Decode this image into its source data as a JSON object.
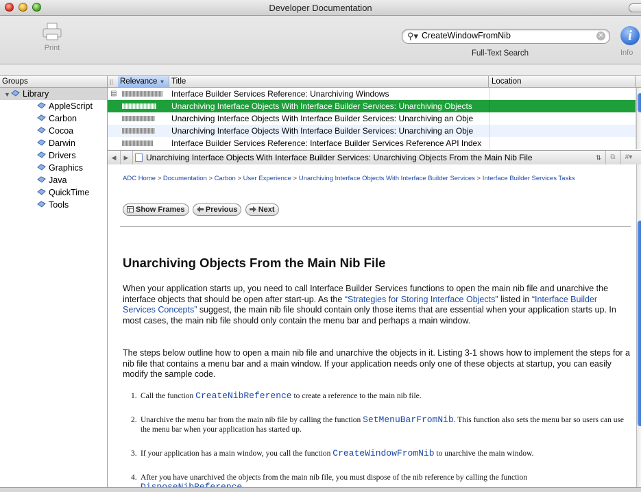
{
  "window": {
    "title": "Developer Documentation"
  },
  "toolbar": {
    "print_label": "Print",
    "search_value": "CreateWindowFromNib",
    "search_caption": "Full-Text Search",
    "info_label": "Info"
  },
  "groups": {
    "header": "Groups",
    "library": "Library",
    "items": [
      "AppleScript",
      "Carbon",
      "Cocoa",
      "Darwin",
      "Drivers",
      "Graphics",
      "Java",
      "QuickTime",
      "Tools"
    ]
  },
  "results": {
    "col_relevance": "Relevance",
    "col_title": "Title",
    "col_location": "Location",
    "rows": [
      {
        "relevance": 0.95,
        "title": "Interface Builder Services Reference: Unarchiving Windows",
        "location": ""
      },
      {
        "relevance": 0.8,
        "title": "Unarchiving Interface Objects With Interface Builder Services: Unarchiving Objects",
        "location": ""
      },
      {
        "relevance": 0.78,
        "title": "Unarchiving Interface Objects With Interface Builder Services: Unarchiving an Obje",
        "location": ""
      },
      {
        "relevance": 0.78,
        "title": "Unarchiving Interface Objects With Interface Builder Services: Unarchiving an Obje",
        "location": ""
      },
      {
        "relevance": 0.72,
        "title": "Interface Builder Services Reference: Interface Builder Services Reference API Index",
        "location": ""
      }
    ],
    "selected_index": 1
  },
  "navbar": {
    "page_title": "Unarchiving Interface Objects With Interface Builder Services: Unarchiving Objects From the Main Nib File"
  },
  "content": {
    "breadcrumb": [
      "ADC Home",
      "Documentation",
      "Carbon",
      "User Experience",
      "Unarchiving Interface Objects With Interface Builder Services",
      "Interface Builder Services Tasks"
    ],
    "breadcrumb_sep": ">",
    "show_frames": "Show Frames",
    "previous": "Previous",
    "next": "Next",
    "heading": "Unarchiving Objects From the Main Nib File",
    "p1_a": "When your application starts up, you need to call Interface Builder Services functions to open the main nib file and unarchive the interface objects that should be open after start-up. As the ",
    "p1_link1": "“Strategies for Storing Interface Objects”",
    "p1_b": " listed in ",
    "p1_link2": "“Interface Builder Services Concepts”",
    "p1_c": " suggest, the main nib file should contain only those items that are essential when your application starts up. In most cases, the main nib file should only contain the menu bar and perhaps a main window.",
    "p2": "The steps below outline how to open a main nib file and unarchive the objects in it. Listing 3-1 shows how to implement the steps for a nib file that contains a menu bar and a main window. If your application needs only one of these objects at startup, you can easily modify the sample code.",
    "steps": [
      {
        "num": "1.",
        "a": "Call the function ",
        "code": "CreateNibReference",
        "b": " to create a reference to the main nib file."
      },
      {
        "num": "2.",
        "a": "Unarchive the menu bar from the main nib file by calling the function ",
        "code": "SetMenuBarFromNib",
        "b": ". This function also sets the menu bar so users can use the menu bar when your application has started up."
      },
      {
        "num": "3.",
        "a": "If your application has a main window, you call the function ",
        "code": "CreateWindowFromNib",
        "b": " to unarchive the main window."
      },
      {
        "num": "4.",
        "a": "After you have unarchived the objects from the main nib file, you must dispose of the nib reference by calling the function ",
        "code": "DisposeNibReference",
        "b": "."
      }
    ]
  },
  "colors": {
    "selection": "#1e9f3a",
    "link": "#1a4aa8",
    "accent": "#3c78d8"
  }
}
